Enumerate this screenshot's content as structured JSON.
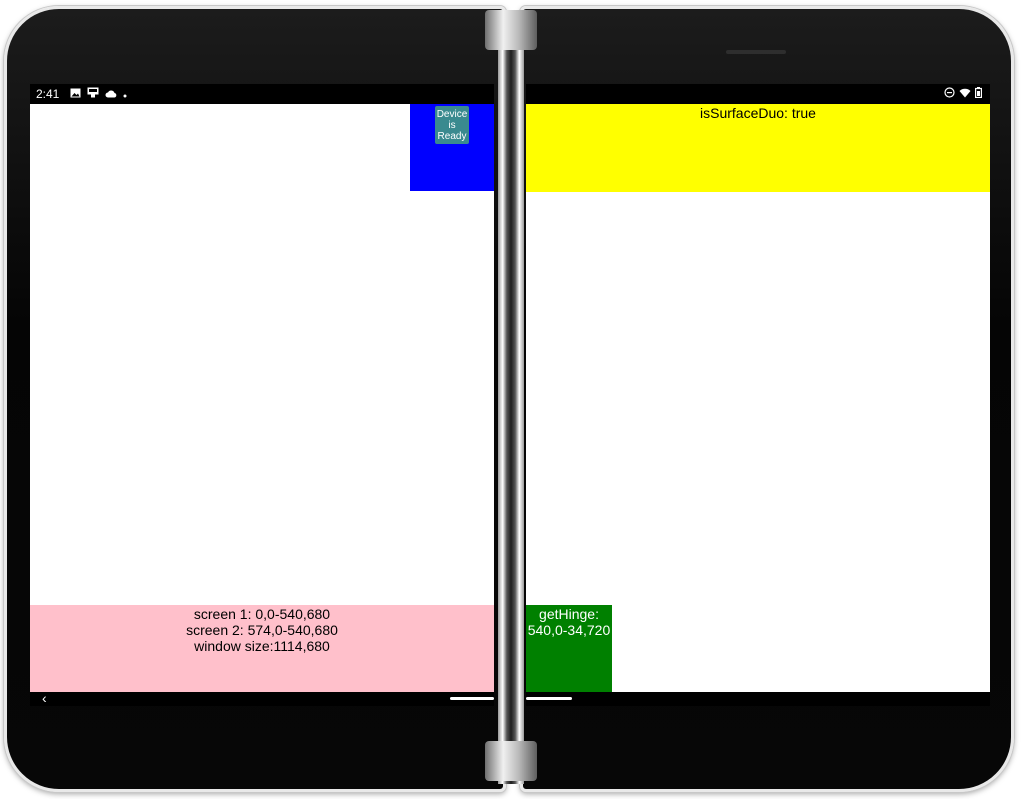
{
  "status_bar": {
    "time": "2:41",
    "left_icons": [
      "image-icon",
      "cast-icon",
      "cloud-icon",
      "dot-icon"
    ],
    "right_icons": [
      "do-not-disturb-icon",
      "wifi-icon",
      "battery-icon"
    ]
  },
  "left_screen": {
    "ready_button_label": "Device is Ready",
    "blue_box_color": "#0000ff",
    "pink_panel": {
      "color": "#ffc0cb",
      "lines": [
        "screen 1: 0,0-540,680",
        "screen 2: 574,0-540,680",
        "window size:1114,680"
      ]
    }
  },
  "right_screen": {
    "yellow_panel": {
      "color": "#ffff00",
      "text": "isSurfaceDuo: true"
    },
    "green_box": {
      "color": "#008000",
      "lines": [
        "getHinge:",
        "540,0-34,720"
      ]
    }
  },
  "nav": {
    "back_icon": "back-chevron-icon"
  }
}
